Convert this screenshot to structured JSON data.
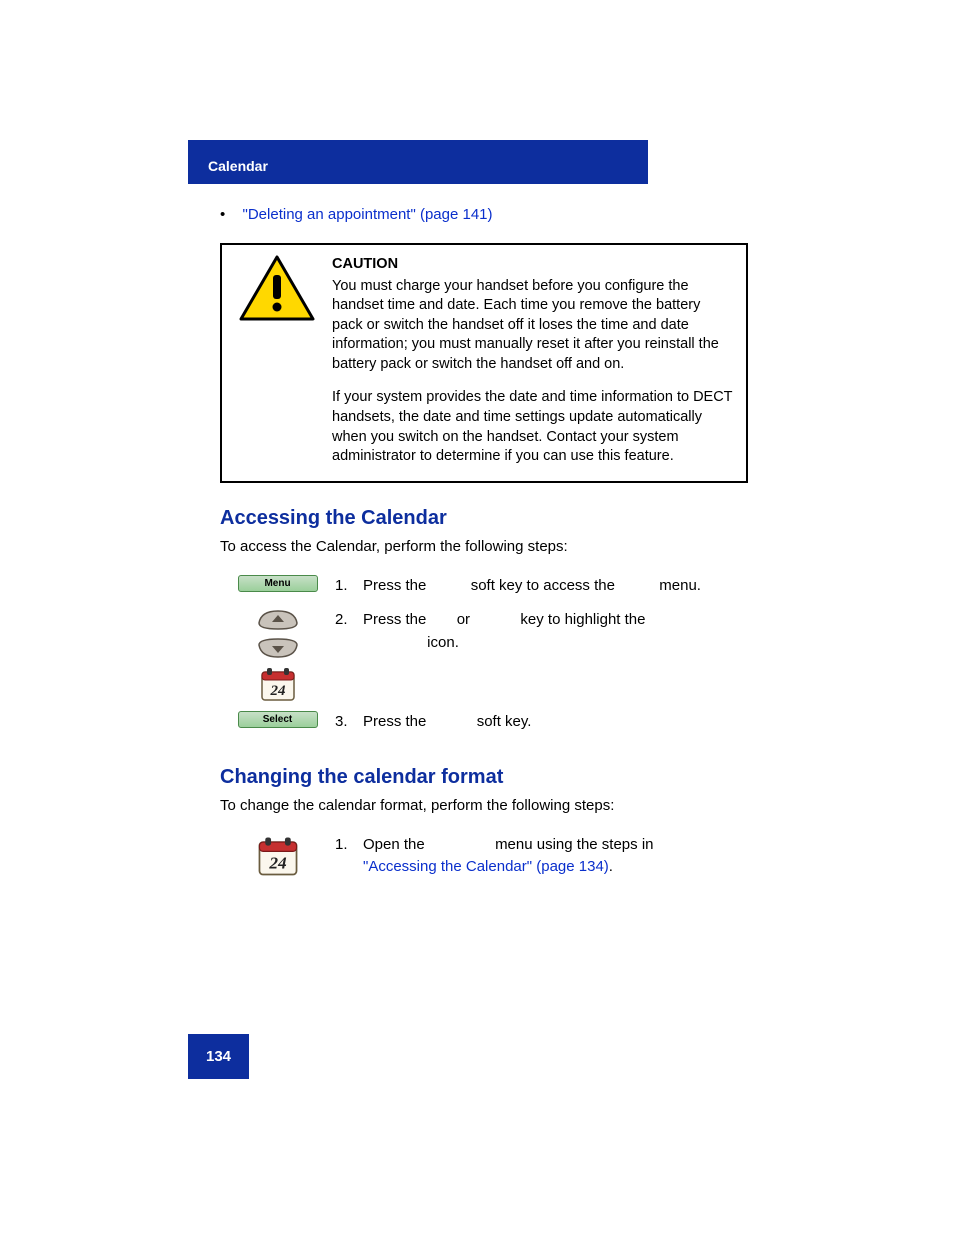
{
  "header": {
    "title": "Calendar"
  },
  "bullet": {
    "dot": "•",
    "link": "\"Deleting an appointment\" (page 141)"
  },
  "caution": {
    "title": "CAUTION",
    "para1": "You must charge your handset before you configure the handset time and date. Each time you remove the battery pack or switch the handset off it loses the time and date information; you must manually reset it after you reinstall the battery pack or switch the handset off and on.",
    "para2": "If your system provides the date and time information to DECT handsets, the date and time settings update automatically when you switch on the handset. Contact your system administrator to determine if you can use this feature."
  },
  "section1": {
    "heading": "Accessing the Calendar",
    "intro": "To access the Calendar, perform the following steps:",
    "softkey_menu": "Menu",
    "softkey_select": "Select",
    "steps": {
      "n1": "1.",
      "t1a": "Press the ",
      "t1b": " soft key to access the ",
      "t1c": " menu.",
      "n2": "2.",
      "t2a": "Press the ",
      "t2b": " or ",
      "t2c": " key to highlight the",
      "t2d": " icon.",
      "n3": "3.",
      "t3a": "Press the ",
      "t3b": " soft key."
    }
  },
  "section2": {
    "heading": "Changing the calendar format",
    "intro": "To change the calendar format, perform the following steps:",
    "steps": {
      "n1": "1.",
      "t1a": "Open the ",
      "t1b": " menu using the steps in ",
      "link": "\"Accessing the Calendar\" (page 134)",
      "period": "."
    }
  },
  "calendar_day": "24",
  "page_number": "134"
}
